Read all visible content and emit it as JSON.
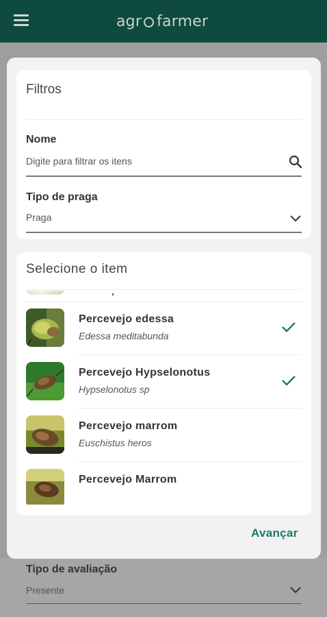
{
  "header": {
    "logo_left": "agr",
    "logo_right": "farmer",
    "menu_icon": "hamburger-menu-icon"
  },
  "colors": {
    "appbar": "#0f4a3f",
    "accent": "#1a7b6b"
  },
  "filters": {
    "title": "Filtros",
    "name_label": "Nome",
    "search_placeholder": "Digite para filtrar os itens",
    "pest_type_label": "Tipo de praga",
    "pest_type_value": "Praga"
  },
  "items": {
    "title": "Selecione o item",
    "list": [
      {
        "name": "Percevejo edessa",
        "scientific": "Edessa meditabunda",
        "selected": true
      },
      {
        "name": "Percevejo Hypselonotus",
        "scientific": "Hypselonotus sp",
        "selected": true
      },
      {
        "name": "Percevejo marrom",
        "scientific": "Euschistus heros",
        "selected": false
      },
      {
        "name": "Percevejo Marrom",
        "scientific": "",
        "selected": false
      }
    ]
  },
  "actions": {
    "next_label": "Avançar"
  },
  "background_form": {
    "evaluation_label": "Tipo de avaliação",
    "evaluation_value": "Presente"
  }
}
